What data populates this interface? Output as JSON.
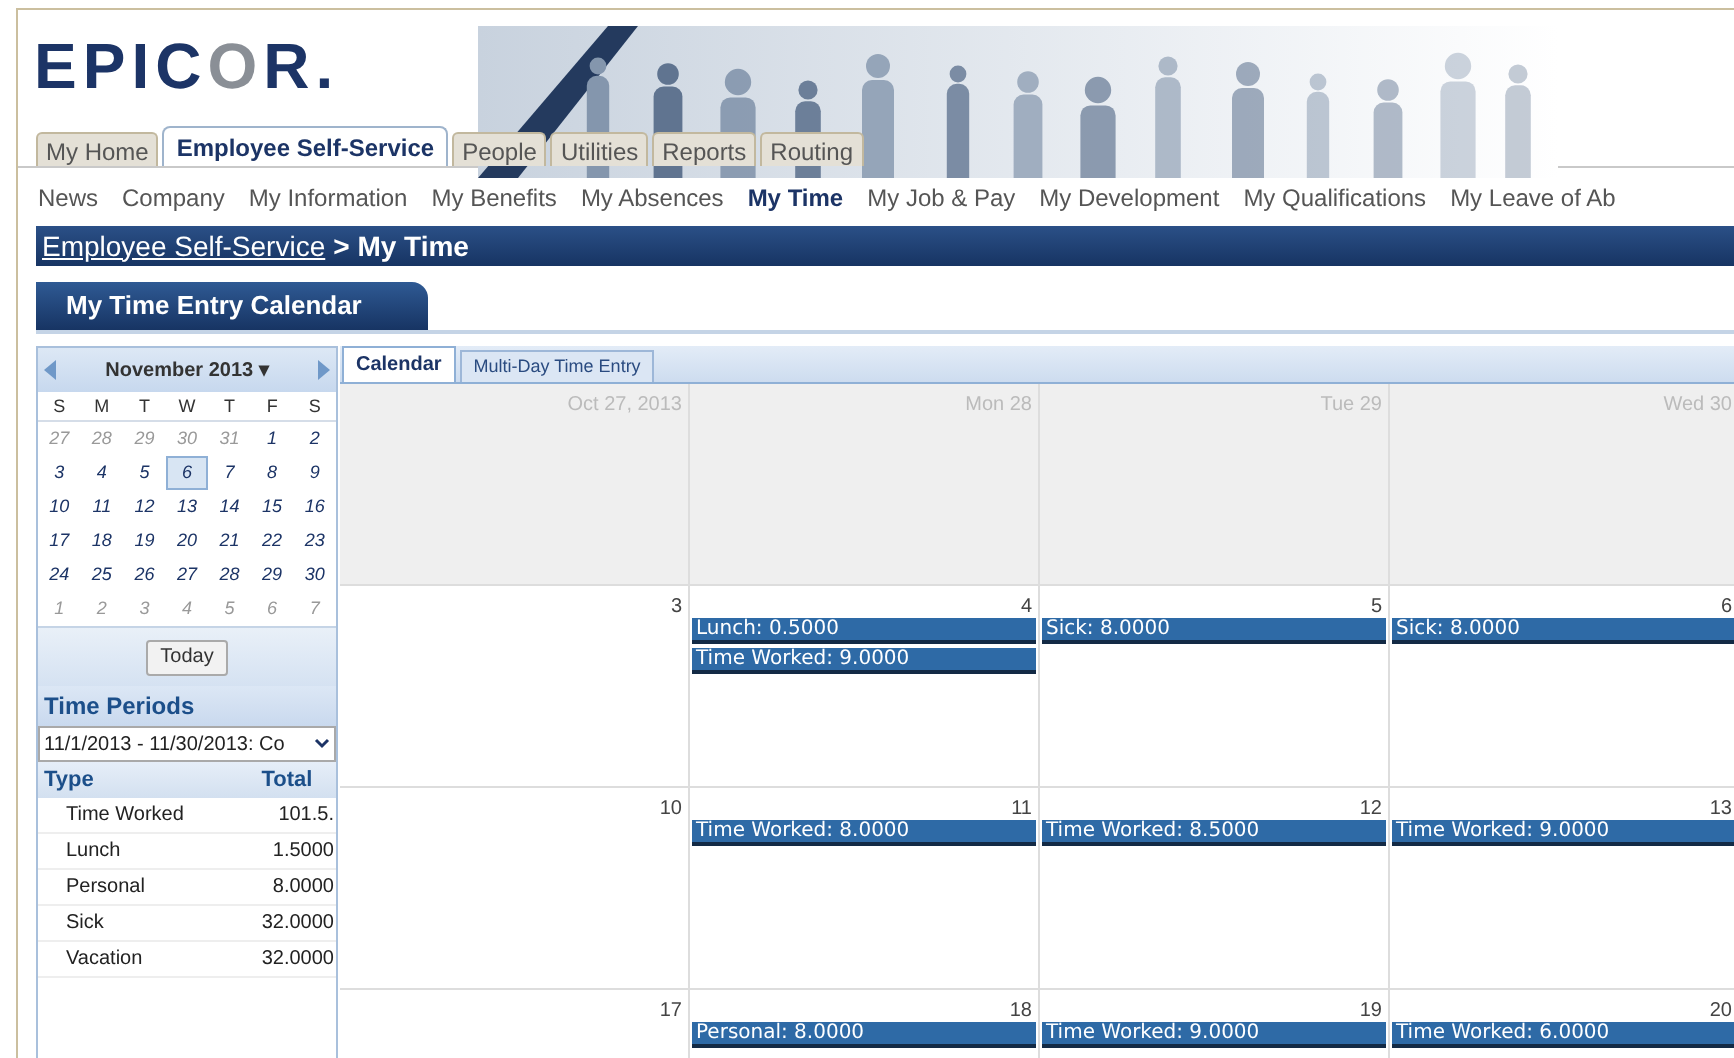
{
  "logo": [
    {
      "text": "EPIC",
      "kind": "dark"
    },
    {
      "text": "O",
      "kind": "grey"
    },
    {
      "text": "R",
      "kind": "dark"
    },
    {
      "text": ".",
      "kind": "dark"
    }
  ],
  "top_tabs": [
    {
      "label": "My Home",
      "selected": false
    },
    {
      "label": "Employee Self-Service",
      "selected": true
    },
    {
      "label": "People",
      "selected": false
    },
    {
      "label": "Utilities",
      "selected": false
    },
    {
      "label": "Reports",
      "selected": false
    },
    {
      "label": "Routing",
      "selected": false
    }
  ],
  "nav_items": [
    {
      "label": "News",
      "selected": false
    },
    {
      "label": "Company",
      "selected": false
    },
    {
      "label": "My Information",
      "selected": false
    },
    {
      "label": "My Benefits",
      "selected": false
    },
    {
      "label": "My Absences",
      "selected": false
    },
    {
      "label": "My Time",
      "selected": true
    },
    {
      "label": "My Job & Pay",
      "selected": false
    },
    {
      "label": "My Development",
      "selected": false
    },
    {
      "label": "My Qualifications",
      "selected": false
    },
    {
      "label": "My Leave of Ab",
      "selected": false
    }
  ],
  "breadcrumb": {
    "link": "Employee Self-Service",
    "current": "> My Time"
  },
  "section_tab": "My Time Entry Calendar",
  "mini_calendar": {
    "month": "November 2013",
    "month_caret": "▾",
    "weekdays": [
      "S",
      "M",
      "T",
      "W",
      "T",
      "F",
      "S"
    ],
    "weeks": [
      [
        {
          "label": "27",
          "in_month": false,
          "selected": false
        },
        {
          "label": "28",
          "in_month": false,
          "selected": false
        },
        {
          "label": "29",
          "in_month": false,
          "selected": false
        },
        {
          "label": "30",
          "in_month": false,
          "selected": false
        },
        {
          "label": "31",
          "in_month": false,
          "selected": false
        },
        {
          "label": "1",
          "in_month": true,
          "selected": false
        },
        {
          "label": "2",
          "in_month": true,
          "selected": false
        }
      ],
      [
        {
          "label": "3",
          "in_month": true,
          "selected": false
        },
        {
          "label": "4",
          "in_month": true,
          "selected": false
        },
        {
          "label": "5",
          "in_month": true,
          "selected": false
        },
        {
          "label": "6",
          "in_month": true,
          "selected": true
        },
        {
          "label": "7",
          "in_month": true,
          "selected": false
        },
        {
          "label": "8",
          "in_month": true,
          "selected": false
        },
        {
          "label": "9",
          "in_month": true,
          "selected": false
        }
      ],
      [
        {
          "label": "10",
          "in_month": true,
          "selected": false
        },
        {
          "label": "11",
          "in_month": true,
          "selected": false
        },
        {
          "label": "12",
          "in_month": true,
          "selected": false
        },
        {
          "label": "13",
          "in_month": true,
          "selected": false
        },
        {
          "label": "14",
          "in_month": true,
          "selected": false
        },
        {
          "label": "15",
          "in_month": true,
          "selected": false
        },
        {
          "label": "16",
          "in_month": true,
          "selected": false
        }
      ],
      [
        {
          "label": "17",
          "in_month": true,
          "selected": false
        },
        {
          "label": "18",
          "in_month": true,
          "selected": false
        },
        {
          "label": "19",
          "in_month": true,
          "selected": false
        },
        {
          "label": "20",
          "in_month": true,
          "selected": false
        },
        {
          "label": "21",
          "in_month": true,
          "selected": false
        },
        {
          "label": "22",
          "in_month": true,
          "selected": false
        },
        {
          "label": "23",
          "in_month": true,
          "selected": false
        }
      ],
      [
        {
          "label": "24",
          "in_month": true,
          "selected": false
        },
        {
          "label": "25",
          "in_month": true,
          "selected": false
        },
        {
          "label": "26",
          "in_month": true,
          "selected": false
        },
        {
          "label": "27",
          "in_month": true,
          "selected": false
        },
        {
          "label": "28",
          "in_month": true,
          "selected": false
        },
        {
          "label": "29",
          "in_month": true,
          "selected": false
        },
        {
          "label": "30",
          "in_month": true,
          "selected": false
        }
      ],
      [
        {
          "label": "1",
          "in_month": false,
          "selected": false
        },
        {
          "label": "2",
          "in_month": false,
          "selected": false
        },
        {
          "label": "3",
          "in_month": false,
          "selected": false
        },
        {
          "label": "4",
          "in_month": false,
          "selected": false
        },
        {
          "label": "5",
          "in_month": false,
          "selected": false
        },
        {
          "label": "6",
          "in_month": false,
          "selected": false
        },
        {
          "label": "7",
          "in_month": false,
          "selected": false
        }
      ]
    ],
    "today_button": "Today"
  },
  "time_periods": {
    "title": "Time Periods",
    "period": "11/1/2013 - 11/30/2013: Co",
    "columns": [
      "Type",
      "Total"
    ],
    "rows": [
      {
        "type": "Time Worked",
        "total": "101.5."
      },
      {
        "type": "Lunch",
        "total": "1.5000"
      },
      {
        "type": "Personal",
        "total": "8.0000"
      },
      {
        "type": "Sick",
        "total": "32.0000"
      },
      {
        "type": "Vacation",
        "total": "32.0000"
      }
    ]
  },
  "calendar_tabs": [
    {
      "label": "Calendar",
      "selected": true
    },
    {
      "label": "Multi-Day Time Entry",
      "selected": false
    }
  ],
  "calendar_weeks": [
    {
      "days": [
        {
          "label": "Oct 27, 2013",
          "in_month": false
        },
        {
          "label": "Mon 28",
          "in_month": false
        },
        {
          "label": "Tue 29",
          "in_month": false
        },
        {
          "label": "Wed 30",
          "in_month": false
        }
      ]
    },
    {
      "days": [
        {
          "label": "3",
          "in_month": true
        },
        {
          "label": "4",
          "in_month": true,
          "entries": [
            "Lunch: 0.5000",
            "Time Worked: 9.0000"
          ]
        },
        {
          "label": "5",
          "in_month": true,
          "entries": [
            "Sick: 8.0000"
          ]
        },
        {
          "label": "6",
          "in_month": true,
          "entries": [
            "Sick: 8.0000"
          ]
        }
      ]
    },
    {
      "days": [
        {
          "label": "10",
          "in_month": true
        },
        {
          "label": "11",
          "in_month": true,
          "entries": [
            "Time Worked: 8.0000"
          ]
        },
        {
          "label": "12",
          "in_month": true,
          "entries": [
            "Time Worked: 8.5000"
          ]
        },
        {
          "label": "13",
          "in_month": true,
          "entries": [
            "Time Worked: 9.0000"
          ]
        }
      ]
    },
    {
      "days": [
        {
          "label": "17",
          "in_month": true
        },
        {
          "label": "18",
          "in_month": true,
          "entries": [
            "Personal: 8.0000"
          ]
        },
        {
          "label": "19",
          "in_month": true,
          "entries": [
            "Time Worked: 9.0000"
          ]
        },
        {
          "label": "20",
          "in_month": true,
          "entries": [
            "Time Worked: 6.0000"
          ]
        }
      ]
    }
  ]
}
